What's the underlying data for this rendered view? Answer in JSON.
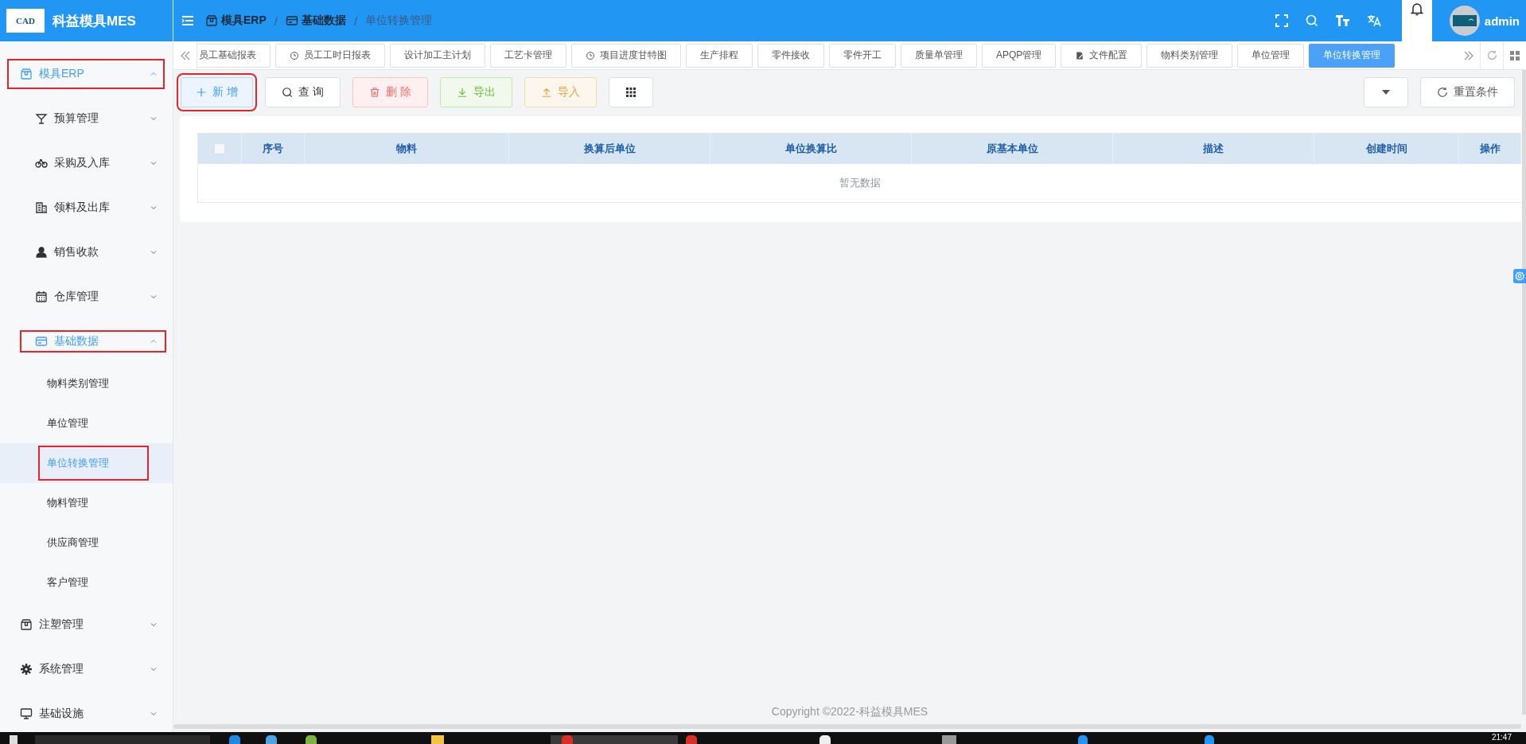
{
  "header": {
    "logo_text": "CAD",
    "app_title": "科益模具MES",
    "breadcrumbs": [
      "模具ERP",
      "基础数据",
      "单位转换管理"
    ],
    "breadcrumb_separators": [
      "/",
      "/"
    ],
    "user": "admin"
  },
  "sidebar": {
    "items": [
      {
        "label": "模具ERP",
        "expanded": true,
        "highlighted": true,
        "children": [
          {
            "label": "预算管理",
            "expanded": false
          },
          {
            "label": "采购及入库",
            "expanded": false
          },
          {
            "label": "领料及出库",
            "expanded": false
          },
          {
            "label": "销售收款",
            "expanded": false
          },
          {
            "label": "仓库管理",
            "expanded": false
          },
          {
            "label": "基础数据",
            "expanded": true,
            "highlighted": true,
            "children": [
              {
                "label": "物料类别管理",
                "selected": false
              },
              {
                "label": "单位管理",
                "selected": false
              },
              {
                "label": "单位转换管理",
                "selected": true,
                "highlighted": true
              },
              {
                "label": "物料管理",
                "selected": false
              },
              {
                "label": "供应商管理",
                "selected": false
              },
              {
                "label": "客户管理",
                "selected": false
              }
            ]
          }
        ]
      },
      {
        "label": "注塑管理",
        "expanded": false
      },
      {
        "label": "系统管理",
        "expanded": false
      },
      {
        "label": "基础设施",
        "expanded": false
      }
    ]
  },
  "tabs": [
    {
      "label": "员工基础报表",
      "selected": false
    },
    {
      "label": "员工工时日报表",
      "selected": false
    },
    {
      "label": "设计加工主计划",
      "selected": false
    },
    {
      "label": "工艺卡管理",
      "selected": false
    },
    {
      "label": "项目进度甘特图",
      "selected": false
    },
    {
      "label": "生产排程",
      "selected": false
    },
    {
      "label": "零件接收",
      "selected": false
    },
    {
      "label": "零件开工",
      "selected": false
    },
    {
      "label": "质量单管理",
      "selected": false
    },
    {
      "label": "APQP管理",
      "selected": false
    },
    {
      "label": "文件配置",
      "selected": false
    },
    {
      "label": "物料类别管理",
      "selected": false
    },
    {
      "label": "单位管理",
      "selected": false
    },
    {
      "label": "单位转换管理",
      "selected": true
    }
  ],
  "toolbar": {
    "buttons": [
      {
        "label": "新 增",
        "kind": "primary",
        "highlighted": true
      },
      {
        "label": "查 询",
        "kind": "default"
      },
      {
        "label": "删 除",
        "kind": "danger"
      },
      {
        "label": "导出",
        "kind": "success"
      },
      {
        "label": "导入",
        "kind": "warning"
      }
    ],
    "reset_label": "重置条件"
  },
  "table": {
    "select_all_checked": false,
    "columns": [
      "序号",
      "物料",
      "换算后单位",
      "单位换算比",
      "原基本单位",
      "描述",
      "创建时间",
      "操作"
    ],
    "empty_text": "暂无数据"
  },
  "footer": "Copyright ©2022-科益模具MES",
  "taskbar": {
    "clock": "21:47"
  }
}
